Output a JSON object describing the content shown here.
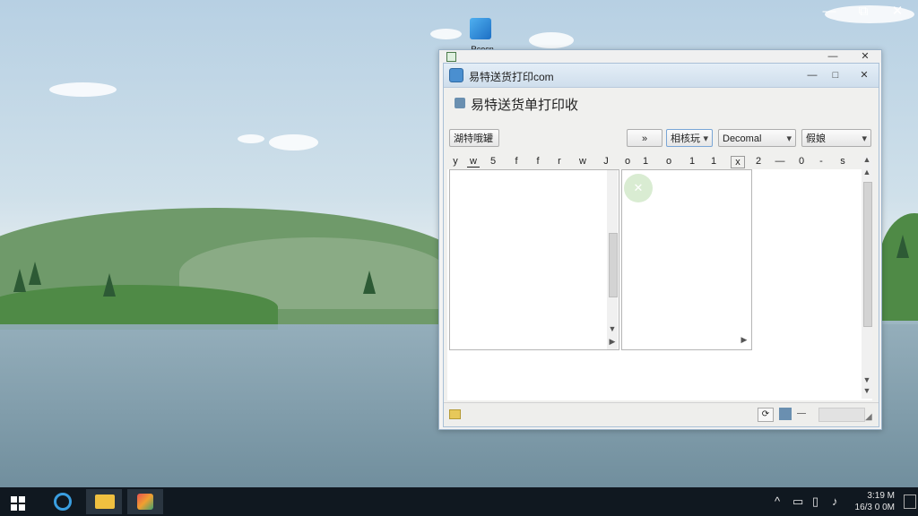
{
  "desktop": {
    "icon_label": "Rcocn"
  },
  "outer_window": {
    "controls": {
      "minimize": "—",
      "maximize": "□",
      "close": "✕"
    }
  },
  "app_window": {
    "title": "易特送货打印com",
    "controls": {
      "minimize": "—",
      "maximize": "□",
      "close": "✕"
    },
    "heading": "易特送货单打印收",
    "toolbar": {
      "left_button": "湖特哦罐",
      "nav_button": "»",
      "select_1": "相核玩",
      "select_2": "Decomal",
      "select_3": "假娘"
    },
    "column_headers": [
      "y",
      "w",
      "5",
      "f",
      "f",
      "r",
      "w",
      "J",
      "o",
      "1",
      "o",
      "1",
      "1",
      "x",
      "2",
      "—",
      "0",
      "-",
      "s"
    ]
  },
  "taskbar": {
    "start_icon": "windows-logo",
    "apps": [
      "edge-icon",
      "file-explorer-icon",
      "store-icon"
    ],
    "tray": {
      "time": "3:19 M",
      "date": "16/3 0 0M"
    }
  },
  "colors": {
    "title_bar": "#cfdeec",
    "taskbar": "#101820",
    "accent": "#4a8fd0"
  }
}
